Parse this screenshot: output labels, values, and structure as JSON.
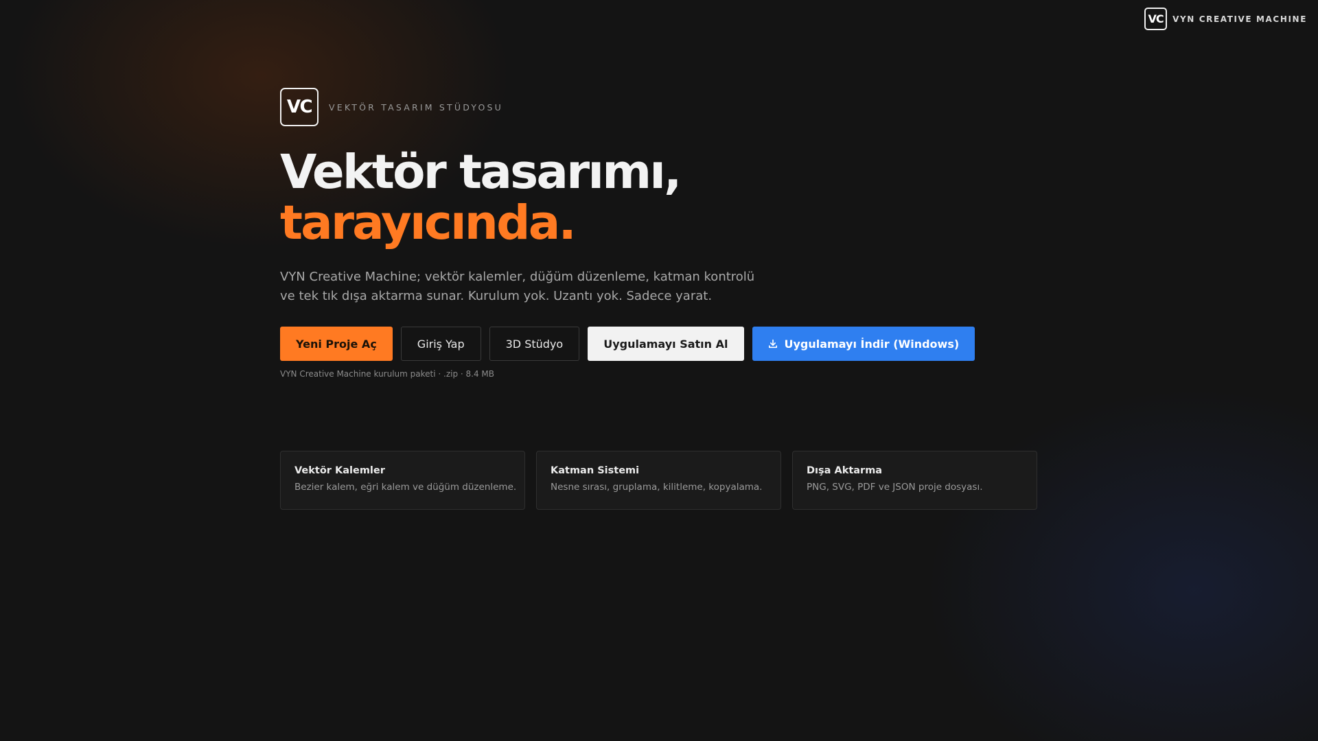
{
  "top_brand": {
    "logo_text": "VC",
    "name": "VYN CREATIVE MACHINE"
  },
  "hero": {
    "logo_text": "VC",
    "eyebrow": "VEKTÖR TASARIM STÜDYOSU",
    "headline_line1": "Vektör tasarımı,",
    "headline_line2": "tarayıcında.",
    "lead": "VYN Creative Machine; vektör kalemler, düğüm düzenleme, katman kontrolü ve tek tık dışa aktarma sunar. Kurulum yok. Uzantı yok. Sadece yarat."
  },
  "actions": {
    "new_project": "Yeni Proje Aç",
    "login": "Giriş Yap",
    "studio_3d": "3D Stüdyo",
    "buy": "Uygulamayı Satın Al",
    "download": "Uygulamayı İndir (Windows)"
  },
  "download_note": "VYN Creative Machine kurulum paketi · .zip · 8.4 MB",
  "features": [
    {
      "title": "Vektör Kalemler",
      "desc": "Bezier kalem, eğri kalem ve düğüm düzenleme."
    },
    {
      "title": "Katman Sistemi",
      "desc": "Nesne sırası, gruplama, kilitleme, kopyalama."
    },
    {
      "title": "Dışa Aktarma",
      "desc": "PNG, SVG, PDF ve JSON proje dosyası."
    }
  ],
  "colors": {
    "accent_orange": "#ff7a22",
    "accent_blue": "#2f7ff0",
    "background": "#141414"
  },
  "icons": {
    "download": "download-icon"
  }
}
